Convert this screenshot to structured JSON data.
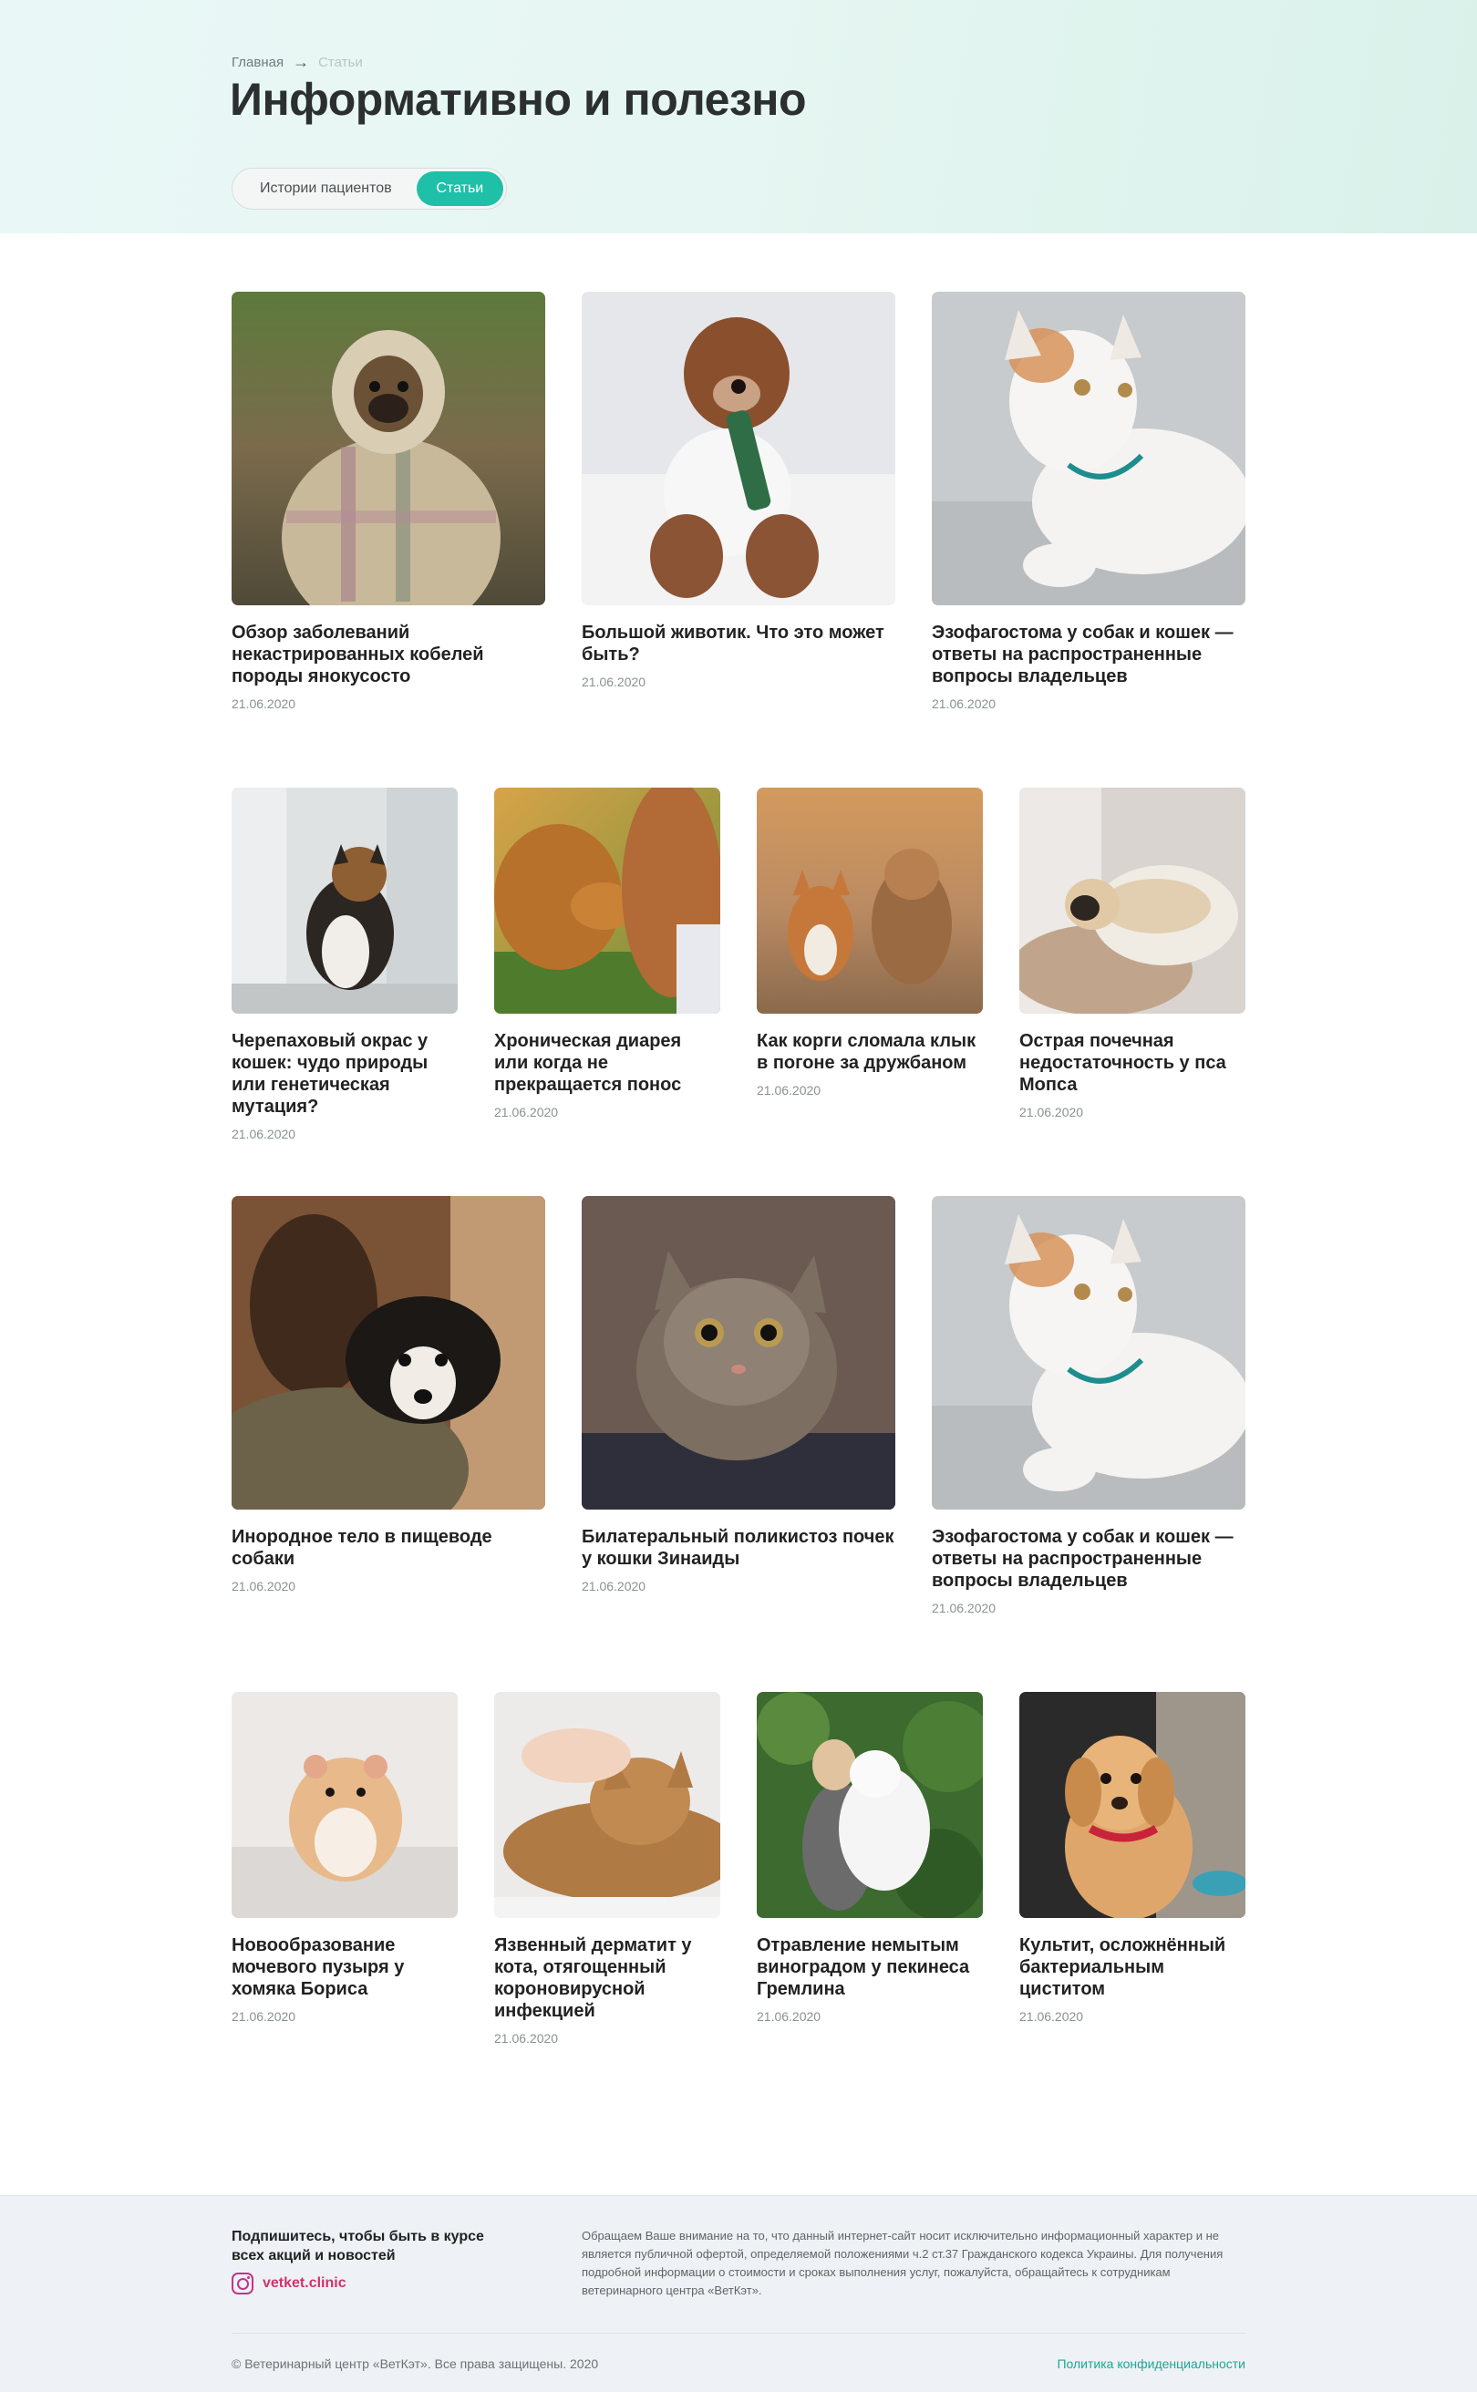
{
  "breadcrumb": {
    "home": "Главная",
    "current": "Статьи"
  },
  "page_title": "Информативно и полезно",
  "tabs": {
    "stories": "Истории пациентов",
    "articles": "Статьи"
  },
  "accent_color": "#1fbfa8",
  "articles": [
    {
      "title": "Обзор заболеваний некастрированных кобелей породы янокусосто",
      "date": "21.06.2020",
      "image": "pug-in-blanket"
    },
    {
      "title": "Большой животик. Что это может быть?",
      "date": "21.06.2020",
      "image": "puppy-with-bottle"
    },
    {
      "title": "Эзофагостома у собак и кошек — ответы на распространенные вопросы владельцев",
      "date": "21.06.2020",
      "image": "white-cat-on-sofa"
    },
    {
      "title": "Черепаховый окрас у кошек: чудо природы или генетическая мутация?",
      "date": "21.06.2020",
      "image": "calico-cat-at-window"
    },
    {
      "title": "Хроническая диарея или когда не прекращается понос",
      "date": "21.06.2020",
      "image": "golden-retriever-with-girl"
    },
    {
      "title": "Как корги сломала клык в погоне за дружбаном",
      "date": "21.06.2020",
      "image": "corgi-and-terrier"
    },
    {
      "title": "Острая почечная недостаточность у пса Мопса",
      "date": "21.06.2020",
      "image": "pug-on-sofa"
    },
    {
      "title": "Инородное тело в пищеводе собаки",
      "date": "21.06.2020",
      "image": "woman-holding-puppy"
    },
    {
      "title": "Билатеральный поликистоз почек у кошки Зинаиды",
      "date": "21.06.2020",
      "image": "tabby-cat"
    },
    {
      "title": "Эзофагостома у собак и кошек — ответы на распространенные вопросы владельцев",
      "date": "21.06.2020",
      "image": "white-cat-on-sofa"
    },
    {
      "title": "Новообразование мочевого пузыря у хомяка Бориса",
      "date": "21.06.2020",
      "image": "hamster"
    },
    {
      "title": "Язвенный дерматит у кота, отягощенный короновирусной инфекцией",
      "date": "21.06.2020",
      "image": "bengal-cat-petted"
    },
    {
      "title": "Отравление немытым виноградом у пекинеса Гремлина",
      "date": "21.06.2020",
      "image": "woman-with-white-dog"
    },
    {
      "title": "Культит, осложнённый бактериальным циститом",
      "date": "21.06.2020",
      "image": "golden-puppy"
    }
  ],
  "footer": {
    "subscribe_title": "Подпишитесь, чтобы быть в курсе всех акций и новостей",
    "instagram": "vetket.clinic",
    "disclaimer": "Обращаем Ваше внимание на то, что данный интернет-сайт носит исключительно информационный характер и не является публичной офертой, определяемой положениями ч.2 ст.37 Гражданского кодекса Украины. Для получения подробной информации о стоимости и сроках выполнения услуг, пожалуйста, обращайтесь к сотрудникам ветеринарного центра «ВетКэт».",
    "copyright": "© Ветеринарный центр «ВетКэт». Все права защищены. 2020",
    "privacy": "Политика конфиденциальности"
  }
}
